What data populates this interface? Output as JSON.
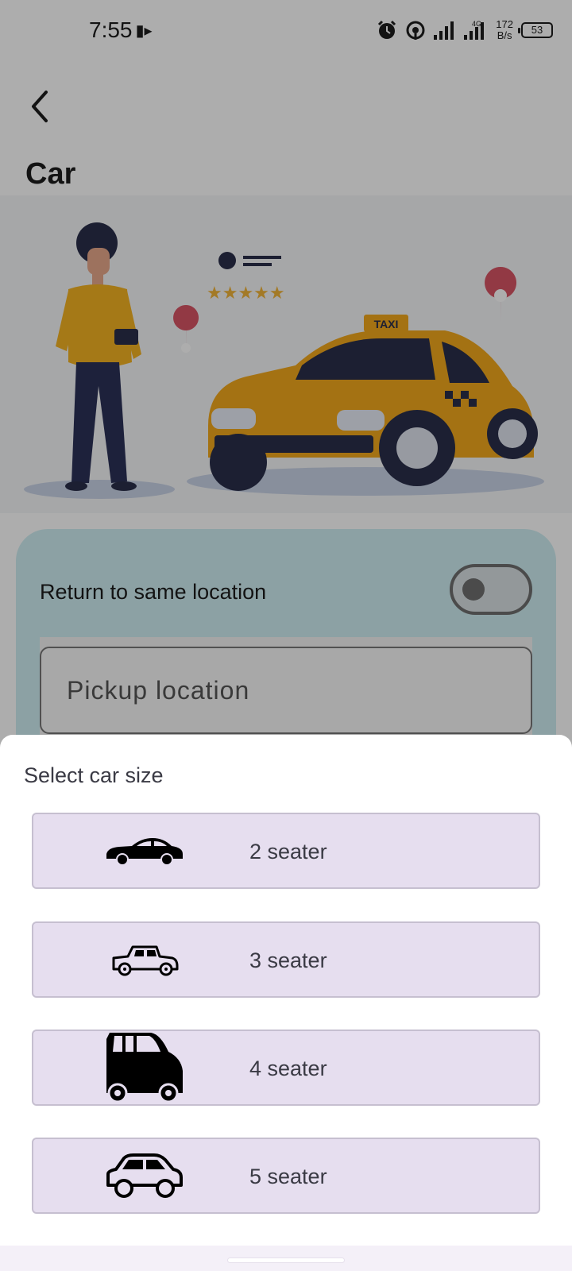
{
  "status_bar": {
    "time": "7:55",
    "net_speed_value": "172",
    "net_speed_unit": "B/s",
    "network_type": "4G",
    "battery": "53"
  },
  "header": {
    "title": "Car"
  },
  "form": {
    "return_label": "Return to same location",
    "return_toggle_on": false,
    "pickup_placeholder": "Pickup location"
  },
  "hero": {
    "taxi_sign": "TAXI"
  },
  "sheet": {
    "title": "Select car size",
    "options": [
      {
        "label": "2 seater",
        "icon": "sedan-icon"
      },
      {
        "label": "3 seater",
        "icon": "coupe-icon"
      },
      {
        "label": "4 seater",
        "icon": "minivan-icon"
      },
      {
        "label": "5 seater",
        "icon": "hatchback-icon"
      }
    ]
  }
}
